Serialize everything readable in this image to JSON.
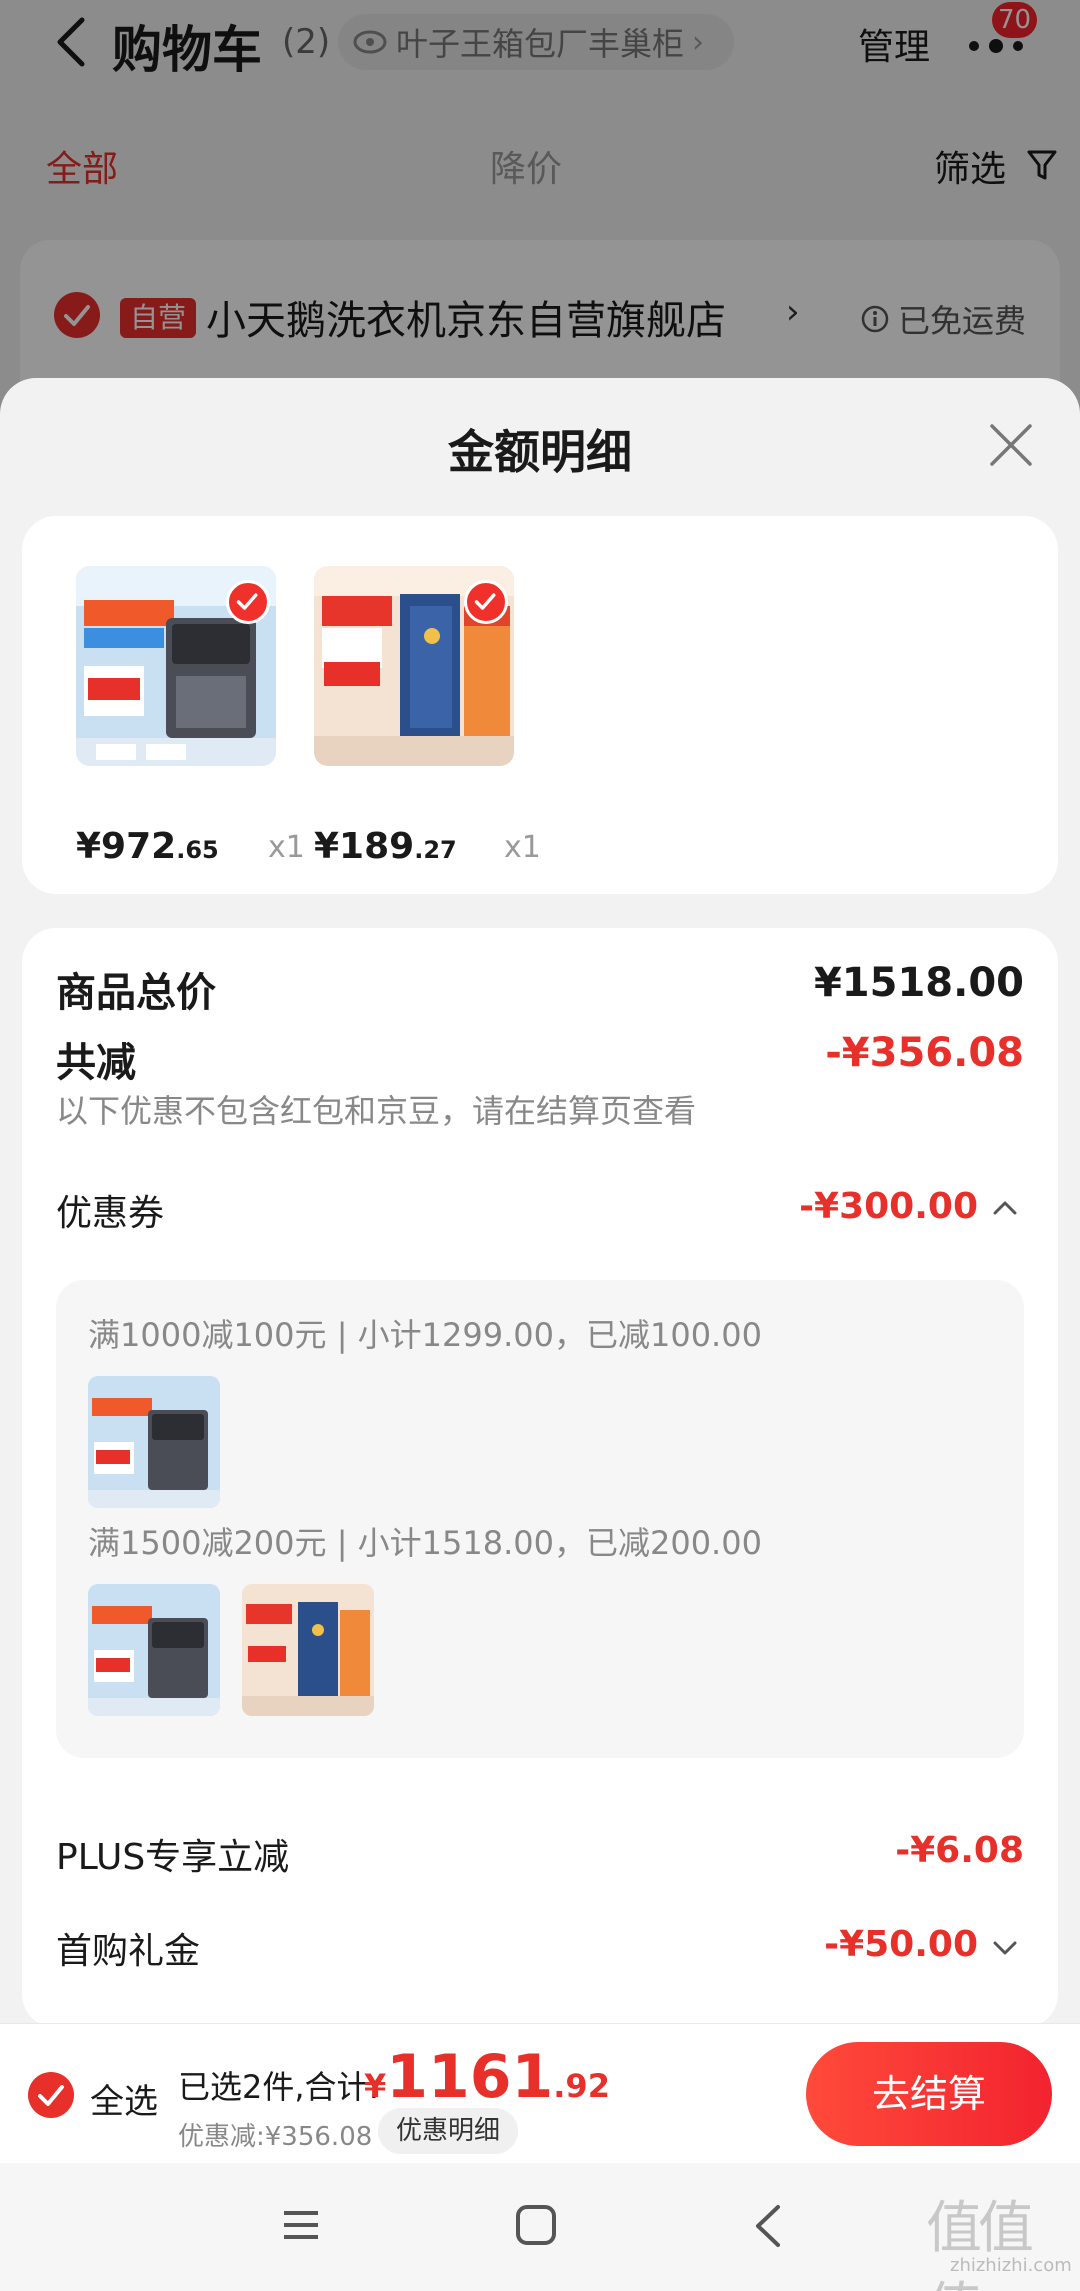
{
  "header": {
    "title": "购物车",
    "count": "(2)",
    "location": "叶子王箱包厂丰巢柜",
    "manage": "管理",
    "badge": "70"
  },
  "tabs": {
    "all": "全部",
    "price_drop": "降价",
    "filter": "筛选"
  },
  "store": {
    "tag": "自营",
    "name": "小天鹅洗衣机京东自营旗舰店",
    "shipping": "已免运费"
  },
  "sheet": {
    "title": "金额明细",
    "items": [
      {
        "price_int": "¥972",
        "price_dec": ".65",
        "qty": "x1"
      },
      {
        "price_int": "¥189",
        "price_dec": ".27",
        "qty": "x1"
      }
    ],
    "total_label": "商品总价",
    "total_value": "¥1518.00",
    "reduce_label": "共减",
    "reduce_value": "-¥356.08",
    "reduce_note": "以下优惠不包含红包和京豆，请在结算页查看",
    "coupon_label": "优惠券",
    "coupon_value": "-¥300.00",
    "coupons": [
      {
        "text": "满1000减100元 | 小计1299.00，已减100.00"
      },
      {
        "text": "满1500减200元 | 小计1518.00，已减200.00"
      }
    ],
    "plus_label": "PLUS专享立减",
    "plus_value": "-¥6.08",
    "first_label": "首购礼金",
    "first_value": "-¥50.00"
  },
  "bottom": {
    "select_all": "全选",
    "selected_info": "已选2件,合计:",
    "total_cur": "¥",
    "total_int": "1161",
    "total_dec": ".92",
    "discount_info": "优惠减:¥356.08",
    "discount_detail_btn": "优惠明细",
    "checkout": "去结算"
  },
  "watermark": {
    "main": "值值值",
    "sub": "zhizhizhi.com"
  },
  "colors": {
    "accent_red": "#e8302b",
    "checkout_gradient_start": "#ff4a3a",
    "checkout_gradient_end": "#f2232f"
  }
}
